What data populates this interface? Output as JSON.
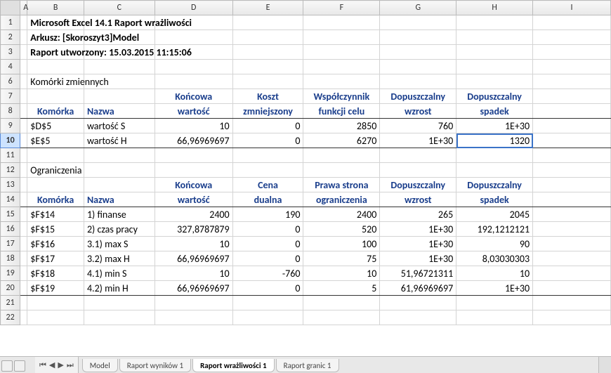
{
  "columns": [
    "A",
    "B",
    "C",
    "D",
    "E",
    "F",
    "G",
    "H",
    "I"
  ],
  "rows": [
    "1",
    "2",
    "3",
    "4",
    "6",
    "7",
    "8",
    "9",
    "10",
    "11",
    "12",
    "13",
    "14",
    "15",
    "16",
    "17",
    "18",
    "19",
    "20",
    "21",
    "22"
  ],
  "title_lines": {
    "l1": "Microsoft Excel 14.1 Raport wrażliwości",
    "l2": "Arkusz: [Skoroszyt3]Model",
    "l3": "Raport utworzony: 15.03.2015 11:15:06"
  },
  "section1_title": "Komórki zmiennych",
  "section2_title": "Ograniczenia",
  "vars_header": {
    "b": "Komórka",
    "c": "Nazwa",
    "d1": "Końcowa",
    "d2": "wartość",
    "e1": "Koszt",
    "e2": "zmniejszony",
    "f1": "Współczynnik",
    "f2": "funkcji celu",
    "g1": "Dopuszczalny",
    "g2": "wzrost",
    "h1": "Dopuszczalny",
    "h2": "spadek"
  },
  "vars_rows": [
    {
      "b": "$D$5",
      "c": "wartość S",
      "d": "10",
      "e": "0",
      "f": "2850",
      "g": "760",
      "h": "1E+30"
    },
    {
      "b": "$E$5",
      "c": "wartość H",
      "d": "66,96969697",
      "e": "0",
      "f": "6270",
      "g": "1E+30",
      "h": "1320"
    }
  ],
  "cons_header": {
    "b": "Komórka",
    "c": "Nazwa",
    "d1": "Końcowa",
    "d2": "wartość",
    "e1": "Cena",
    "e2": "dualna",
    "f1": "Prawa strona",
    "f2": "ograniczenia",
    "g1": "Dopuszczalny",
    "g2": "wzrost",
    "h1": "Dopuszczalny",
    "h2": "spadek"
  },
  "cons_rows": [
    {
      "b": "$F$14",
      "c": "1) finanse",
      "d": "2400",
      "e": "190",
      "f": "2400",
      "g": "265",
      "h": "2045"
    },
    {
      "b": "$F$15",
      "c": "2) czas pracy",
      "d": "327,8787879",
      "e": "0",
      "f": "520",
      "g": "1E+30",
      "h": "192,1212121"
    },
    {
      "b": "$F$16",
      "c": "3.1) max S",
      "d": "10",
      "e": "0",
      "f": "100",
      "g": "1E+30",
      "h": "90"
    },
    {
      "b": "$F$17",
      "c": "3.2) max H",
      "d": "66,96969697",
      "e": "0",
      "f": "75",
      "g": "1E+30",
      "h": "8,03030303"
    },
    {
      "b": "$F$18",
      "c": "4.1) min S",
      "d": "10",
      "e": "-760",
      "f": "10",
      "g": "51,96721311",
      "h": "10"
    },
    {
      "b": "$F$19",
      "c": "4.2) min H",
      "d": "66,96969697",
      "e": "0",
      "f": "5",
      "g": "61,96969697",
      "h": "1E+30"
    }
  ],
  "tabs": {
    "t1": "Model",
    "t2": "Raport wyników 1",
    "t3": "Raport wrażliwości 1",
    "t4": "Raport granic 1"
  },
  "chart_data": {
    "type": "table",
    "tables": [
      {
        "name": "Komórki zmiennych",
        "columns": [
          "Komórka",
          "Nazwa",
          "Końcowa wartość",
          "Koszt zmniejszony",
          "Współczynnik funkcji celu",
          "Dopuszczalny wzrost",
          "Dopuszczalny spadek"
        ],
        "rows": [
          [
            "$D$5",
            "wartość S",
            10,
            0,
            2850,
            760,
            1e+30
          ],
          [
            "$E$5",
            "wartość H",
            66.96969697,
            0,
            6270,
            1e+30,
            1320
          ]
        ]
      },
      {
        "name": "Ograniczenia",
        "columns": [
          "Komórka",
          "Nazwa",
          "Końcowa wartość",
          "Cena dualna",
          "Prawa strona ograniczenia",
          "Dopuszczalny wzrost",
          "Dopuszczalny spadek"
        ],
        "rows": [
          [
            "$F$14",
            "1) finanse",
            2400,
            190,
            2400,
            265,
            2045
          ],
          [
            "$F$15",
            "2) czas pracy",
            327.8787879,
            0,
            520,
            1e+30,
            192.1212121
          ],
          [
            "$F$16",
            "3.1) max S",
            10,
            0,
            100,
            1e+30,
            90
          ],
          [
            "$F$17",
            "3.2) max H",
            66.96969697,
            0,
            75,
            1e+30,
            8.03030303
          ],
          [
            "$F$18",
            "4.1) min S",
            10,
            -760,
            10,
            51.96721311,
            10
          ],
          [
            "$F$19",
            "4.2) min H",
            66.96969697,
            0,
            5,
            61.96969697,
            1e+30
          ]
        ]
      }
    ]
  }
}
